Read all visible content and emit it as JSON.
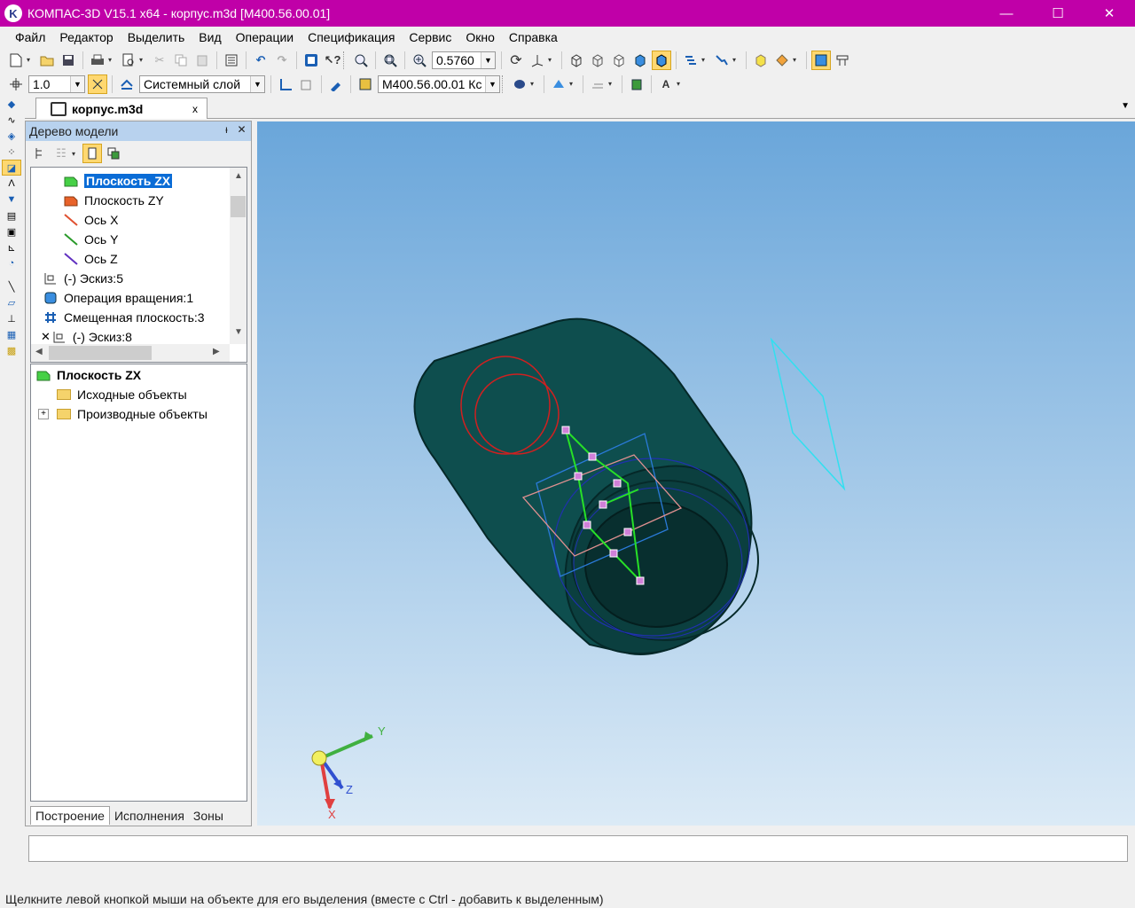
{
  "window": {
    "title": "КОМПАС-3D V15.1 x64 - корпус.m3d [М400.56.00.01]",
    "app_icon_letter": "K",
    "minimize": "—",
    "maximize": "☐",
    "close": "✕"
  },
  "menu": [
    "Файл",
    "Редактор",
    "Выделить",
    "Вид",
    "Операции",
    "Спецификация",
    "Сервис",
    "Окно",
    "Справка"
  ],
  "toolbar1": {
    "zoom_value": "0.5760"
  },
  "toolbar2": {
    "step_value": "1.0",
    "layer_value": "Системный слой",
    "designation_value": "М400.56.00.01 Кс"
  },
  "document_tab": {
    "name": "корпус.m3d",
    "close": "x"
  },
  "tree_panel": {
    "title": "Дерево модели",
    "pin": "ᵻ",
    "close": "✕",
    "items": [
      {
        "label": "Плоскость ZX",
        "selected": true,
        "indent": 1,
        "icon": "plane-green-icon"
      },
      {
        "label": "Плоскость ZY",
        "indent": 1,
        "icon": "plane-red-icon"
      },
      {
        "label": "Ось X",
        "indent": 1,
        "icon": "axis-x-icon"
      },
      {
        "label": "Ось Y",
        "indent": 1,
        "icon": "axis-y-icon"
      },
      {
        "label": "Ось Z",
        "indent": 1,
        "icon": "axis-z-icon"
      },
      {
        "label": "(-) Эскиз:5",
        "indent": 0,
        "icon": "sketch-icon"
      },
      {
        "label": "Операция вращения:1",
        "indent": 0,
        "icon": "revolve-icon"
      },
      {
        "label": "Смещенная плоскость:3",
        "indent": 0,
        "icon": "offset-plane-icon"
      },
      {
        "label": "(-) Эскиз:8",
        "indent": 0,
        "icon": "sketch-icon",
        "error": true
      }
    ],
    "props_root": "Плоскость ZX",
    "props_children": [
      "Исходные объекты",
      "Производные объекты"
    ],
    "bottom_tabs": [
      "Построение",
      "Исполнения",
      "Зоны"
    ]
  },
  "viewport": {
    "axis_labels": {
      "x": "X",
      "y": "Y",
      "z": "Z"
    },
    "body_color": "#0e4e4e"
  },
  "status": {
    "hint": "Щелкните левой кнопкой мыши на объекте для его выделения (вместе с Ctrl - добавить к выделенным)"
  },
  "colors": {
    "title_bar": "#c000a8",
    "selection": "#0a6cd6"
  }
}
